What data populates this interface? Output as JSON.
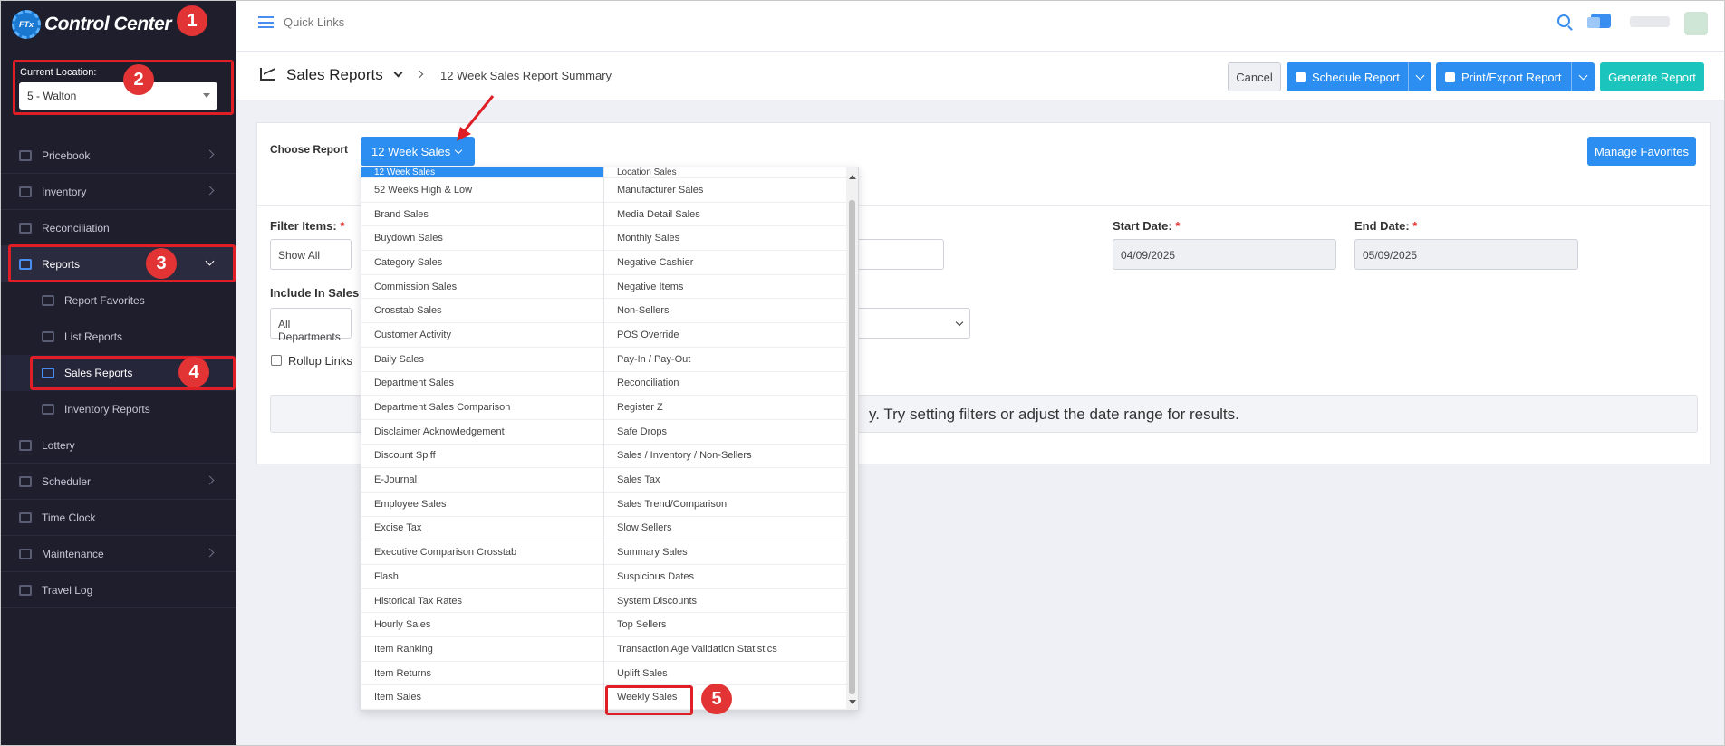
{
  "app": {
    "title": "Control Center",
    "logo_abbr": "FTx"
  },
  "location": {
    "label": "Current Location:",
    "value": "5 - Walton"
  },
  "sidebar": {
    "items": [
      {
        "label": "Pricebook",
        "icon": "calculator-icon"
      },
      {
        "label": "Inventory",
        "icon": "inventory-icon"
      },
      {
        "label": "Reconciliation",
        "icon": "grid-icon"
      },
      {
        "label": "Reports",
        "icon": "bar-chart-icon"
      },
      {
        "label": "Report Favorites",
        "icon": "bookmark-icon"
      },
      {
        "label": "List Reports",
        "icon": "line-chart-icon"
      },
      {
        "label": "Sales Reports",
        "icon": "line-chart-icon"
      },
      {
        "label": "Inventory Reports",
        "icon": "inventory-icon"
      },
      {
        "label": "Lottery",
        "icon": "ticket-icon"
      },
      {
        "label": "Scheduler",
        "icon": "calendar-icon"
      },
      {
        "label": "Time Clock",
        "icon": "clock-icon"
      },
      {
        "label": "Maintenance",
        "icon": "wrench-icon"
      },
      {
        "label": "Travel Log",
        "icon": "car-icon"
      }
    ]
  },
  "topbar": {
    "quick_links": "Quick Links"
  },
  "header": {
    "title": "Sales Reports",
    "breadcrumb": "12 Week Sales Report Summary",
    "cancel": "Cancel",
    "schedule": "Schedule Report",
    "print": "Print/Export Report",
    "generate": "Generate Report"
  },
  "form": {
    "choose_label": "Choose Report",
    "choose_value": "12 Week Sales",
    "manage_favorites": "Manage Favorites",
    "filter_label": "Filter Items:",
    "filter_value": "Show All",
    "start_label": "Start Date:",
    "start_value": "04/09/2025",
    "end_label": "End Date:",
    "end_value": "05/09/2025",
    "include_label": "Include In Sales",
    "include_value": "All Departments",
    "rollup_label": "Rollup Links",
    "empty_message": "y. Try setting filters or adjust the date range for results.",
    "required_mark": "*"
  },
  "dropdown": {
    "col1": [
      "12 Week Sales",
      "52 Weeks High & Low",
      "Brand Sales",
      "Buydown Sales",
      "Category Sales",
      "Commission Sales",
      "Crosstab Sales",
      "Customer Activity",
      "Daily Sales",
      "Department Sales",
      "Department Sales Comparison",
      "Disclaimer Acknowledgement",
      "Discount Spiff",
      "E-Journal",
      "Employee Sales",
      "Excise Tax",
      "Executive Comparison Crosstab",
      "Flash",
      "Historical Tax Rates",
      "Hourly Sales",
      "Item Ranking",
      "Item Returns",
      "Item Sales"
    ],
    "col2": [
      "Location Sales",
      "Manufacturer Sales",
      "Media Detail Sales",
      "Monthly Sales",
      "Negative Cashier",
      "Negative Items",
      "Non-Sellers",
      "POS Override",
      "Pay-In / Pay-Out",
      "Reconciliation",
      "Register Z",
      "Safe Drops",
      "Sales / Inventory / Non-Sellers",
      "Sales Tax",
      "Sales Trend/Comparison",
      "Slow Sellers",
      "Summary Sales",
      "Suspicious Dates",
      "System Discounts",
      "Top Sellers",
      "Transaction Age Validation Statistics",
      "Uplift Sales",
      "Weekly Sales"
    ]
  },
  "callouts": [
    "1",
    "2",
    "3",
    "4",
    "5"
  ],
  "colors": {
    "accent": "#2b8ef0",
    "sidebar_bg": "#1e1e2d",
    "highlight": "#e01e26",
    "generate": "#1bc5bd"
  }
}
